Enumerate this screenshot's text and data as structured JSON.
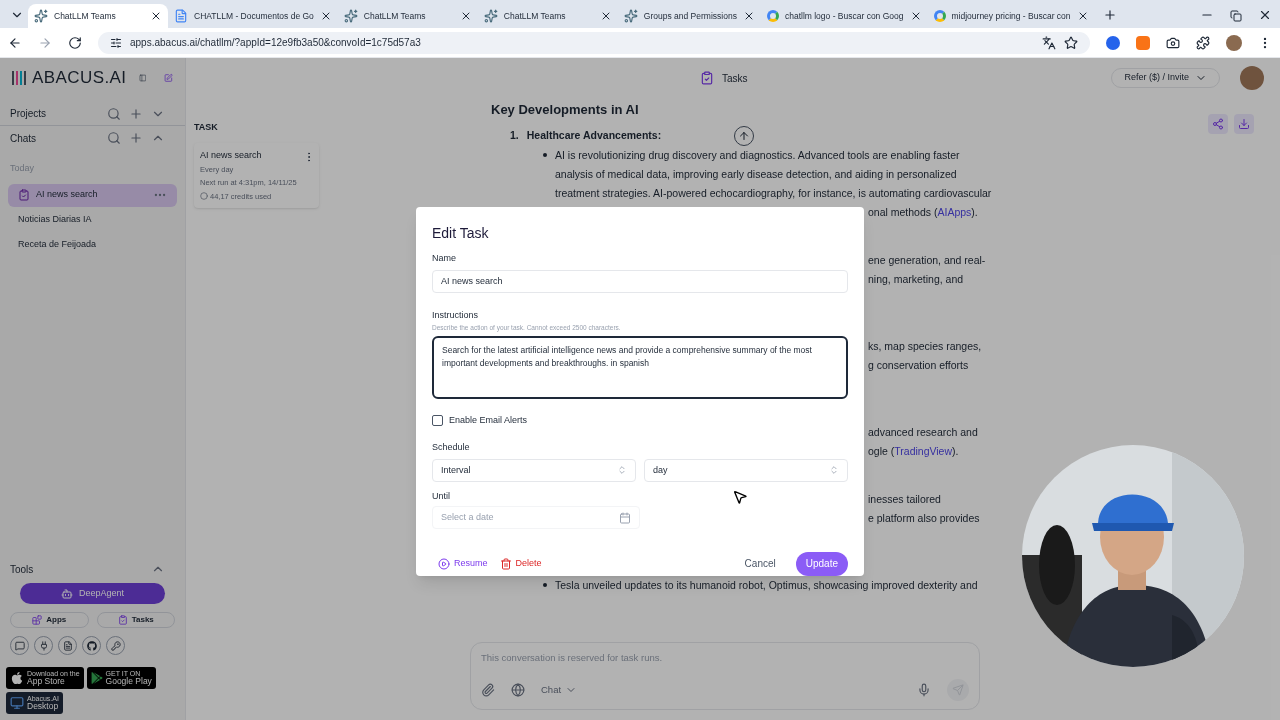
{
  "browser_tabs": [
    {
      "title": "ChatLLM Teams",
      "kind": "abacus",
      "selected": true
    },
    {
      "title": "CHATLLM - Documentos de Go",
      "kind": "docs",
      "selected": false
    },
    {
      "title": "ChatLLM Teams",
      "kind": "abacus",
      "selected": false
    },
    {
      "title": "ChatLLM Teams",
      "kind": "abacus",
      "selected": false
    },
    {
      "title": "Groups and Permissions",
      "kind": "abacus",
      "selected": false
    },
    {
      "title": "chatllm logo - Buscar con Goog",
      "kind": "google",
      "selected": false
    },
    {
      "title": "midjourney pricing - Buscar con",
      "kind": "google",
      "selected": false
    }
  ],
  "address": "apps.abacus.ai/chatllm/?appId=12e9fb3a50&convoId=1c75d57a3",
  "logo": "ABACUS.AI",
  "sidebar": {
    "sections": [
      {
        "title": "Projects",
        "expanded": false
      },
      {
        "title": "Chats",
        "expanded": true
      }
    ],
    "group": "Today",
    "chats": [
      {
        "title": "AI news search",
        "selected": true
      },
      {
        "title": "Noticias Diarias IA",
        "selected": false
      },
      {
        "title": "Receta de Feijoada",
        "selected": false
      }
    ],
    "tools": {
      "title": "Tools",
      "expanded": true,
      "primary": "DeepAgent",
      "buttons": [
        "Apps",
        "Tasks"
      ]
    },
    "stores": [
      {
        "kind": "apple",
        "small": "Download on the",
        "big": "App Store"
      },
      {
        "kind": "google",
        "small": "GET IT ON",
        "big": "Google Play"
      },
      {
        "kind": "desktop",
        "small": "Abacus.AI",
        "big": "Desktop"
      }
    ]
  },
  "task_panel": {
    "heading": "TASK",
    "card": {
      "title": "AI news search",
      "schedule": "Every day",
      "next_run": "Next run at 4:31pm, 14/11/25",
      "credits": "44,17 credits used"
    }
  },
  "header": {
    "title": "Tasks",
    "refer": "Refer ($) / Invite"
  },
  "article": {
    "heading": "Key Developments in AI",
    "section_number": "1.",
    "section_title": "Healthcare Advancements:",
    "lines": [
      "AI is revolutionizing drug discovery and diagnostics. Advanced tools are enabling faster",
      "analysis of medical data, improving early disease detection, and aiding in personalized",
      "treatment strategies. AI-powered echocardiography, for instance, is automating cardiovascular"
    ],
    "covered_blocks": [
      [
        {
          "text": "onal methods (",
          "link": "AIApps",
          "after": ")."
        }
      ],
      [
        {
          "text": "ene generation, and real-"
        },
        {
          "text": "ning, marketing, and"
        }
      ],
      [
        {
          "text": "ks, map species ranges,"
        },
        {
          "text": "g conservation efforts"
        }
      ],
      [
        {
          "text": "advanced research and"
        },
        {
          "text": "ogle (",
          "link": "TradingView",
          "after": ")."
        }
      ],
      [
        {
          "text": "inesses tailored"
        },
        {
          "text": "e platform also provides"
        }
      ]
    ],
    "last_bullet": "Tesla unveiled updates to its humanoid robot, Optimus, showcasing improved dexterity and"
  },
  "composer": {
    "placeholder": "This conversation is reserved for task runs.",
    "mode": "Chat"
  },
  "modal": {
    "title": "Edit Task",
    "name_label": "Name",
    "name_value": "AI news search",
    "instructions_label": "Instructions",
    "instructions_hint": "Describe the action of your task. Cannot exceed 2500 characters.",
    "instructions_value": "Search for the latest artificial intelligence news and provide a comprehensive summary of the most important developments and breakthroughs. in spanish",
    "email_alerts": {
      "label": "Enable Email Alerts",
      "checked": false
    },
    "schedule_label": "Schedule",
    "schedule_type": "Interval",
    "schedule_unit": "day",
    "until_label": "Until",
    "until_placeholder": "Select a date",
    "resume": "Resume",
    "delete": "Delete",
    "cancel": "Cancel",
    "update": "Update"
  }
}
